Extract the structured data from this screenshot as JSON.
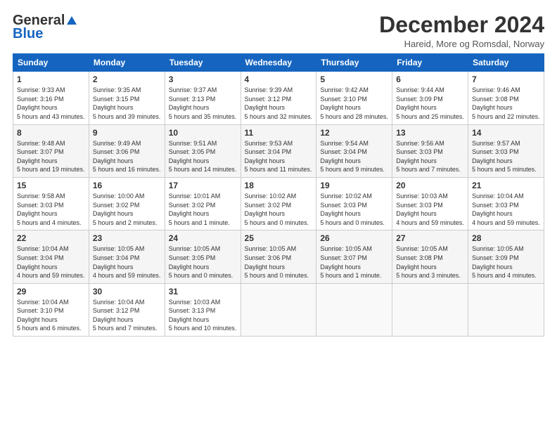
{
  "header": {
    "logo_general": "General",
    "logo_blue": "Blue",
    "title": "December 2024",
    "location": "Hareid, More og Romsdal, Norway"
  },
  "weekdays": [
    "Sunday",
    "Monday",
    "Tuesday",
    "Wednesday",
    "Thursday",
    "Friday",
    "Saturday"
  ],
  "weeks": [
    [
      {
        "day": "1",
        "sunrise": "9:33 AM",
        "sunset": "3:16 PM",
        "daylight": "5 hours and 43 minutes."
      },
      {
        "day": "2",
        "sunrise": "9:35 AM",
        "sunset": "3:15 PM",
        "daylight": "5 hours and 39 minutes."
      },
      {
        "day": "3",
        "sunrise": "9:37 AM",
        "sunset": "3:13 PM",
        "daylight": "5 hours and 35 minutes."
      },
      {
        "day": "4",
        "sunrise": "9:39 AM",
        "sunset": "3:12 PM",
        "daylight": "5 hours and 32 minutes."
      },
      {
        "day": "5",
        "sunrise": "9:42 AM",
        "sunset": "3:10 PM",
        "daylight": "5 hours and 28 minutes."
      },
      {
        "day": "6",
        "sunrise": "9:44 AM",
        "sunset": "3:09 PM",
        "daylight": "5 hours and 25 minutes."
      },
      {
        "day": "7",
        "sunrise": "9:46 AM",
        "sunset": "3:08 PM",
        "daylight": "5 hours and 22 minutes."
      }
    ],
    [
      {
        "day": "8",
        "sunrise": "9:48 AM",
        "sunset": "3:07 PM",
        "daylight": "5 hours and 19 minutes."
      },
      {
        "day": "9",
        "sunrise": "9:49 AM",
        "sunset": "3:06 PM",
        "daylight": "5 hours and 16 minutes."
      },
      {
        "day": "10",
        "sunrise": "9:51 AM",
        "sunset": "3:05 PM",
        "daylight": "5 hours and 14 minutes."
      },
      {
        "day": "11",
        "sunrise": "9:53 AM",
        "sunset": "3:04 PM",
        "daylight": "5 hours and 11 minutes."
      },
      {
        "day": "12",
        "sunrise": "9:54 AM",
        "sunset": "3:04 PM",
        "daylight": "5 hours and 9 minutes."
      },
      {
        "day": "13",
        "sunrise": "9:56 AM",
        "sunset": "3:03 PM",
        "daylight": "5 hours and 7 minutes."
      },
      {
        "day": "14",
        "sunrise": "9:57 AM",
        "sunset": "3:03 PM",
        "daylight": "5 hours and 5 minutes."
      }
    ],
    [
      {
        "day": "15",
        "sunrise": "9:58 AM",
        "sunset": "3:03 PM",
        "daylight": "5 hours and 4 minutes."
      },
      {
        "day": "16",
        "sunrise": "10:00 AM",
        "sunset": "3:02 PM",
        "daylight": "5 hours and 2 minutes."
      },
      {
        "day": "17",
        "sunrise": "10:01 AM",
        "sunset": "3:02 PM",
        "daylight": "5 hours and 1 minute."
      },
      {
        "day": "18",
        "sunrise": "10:02 AM",
        "sunset": "3:02 PM",
        "daylight": "5 hours and 0 minutes."
      },
      {
        "day": "19",
        "sunrise": "10:02 AM",
        "sunset": "3:03 PM",
        "daylight": "5 hours and 0 minutes."
      },
      {
        "day": "20",
        "sunrise": "10:03 AM",
        "sunset": "3:03 PM",
        "daylight": "4 hours and 59 minutes."
      },
      {
        "day": "21",
        "sunrise": "10:04 AM",
        "sunset": "3:03 PM",
        "daylight": "4 hours and 59 minutes."
      }
    ],
    [
      {
        "day": "22",
        "sunrise": "10:04 AM",
        "sunset": "3:04 PM",
        "daylight": "4 hours and 59 minutes."
      },
      {
        "day": "23",
        "sunrise": "10:05 AM",
        "sunset": "3:04 PM",
        "daylight": "4 hours and 59 minutes."
      },
      {
        "day": "24",
        "sunrise": "10:05 AM",
        "sunset": "3:05 PM",
        "daylight": "5 hours and 0 minutes."
      },
      {
        "day": "25",
        "sunrise": "10:05 AM",
        "sunset": "3:06 PM",
        "daylight": "5 hours and 0 minutes."
      },
      {
        "day": "26",
        "sunrise": "10:05 AM",
        "sunset": "3:07 PM",
        "daylight": "5 hours and 1 minute."
      },
      {
        "day": "27",
        "sunrise": "10:05 AM",
        "sunset": "3:08 PM",
        "daylight": "5 hours and 3 minutes."
      },
      {
        "day": "28",
        "sunrise": "10:05 AM",
        "sunset": "3:09 PM",
        "daylight": "5 hours and 4 minutes."
      }
    ],
    [
      {
        "day": "29",
        "sunrise": "10:04 AM",
        "sunset": "3:10 PM",
        "daylight": "5 hours and 6 minutes."
      },
      {
        "day": "30",
        "sunrise": "10:04 AM",
        "sunset": "3:12 PM",
        "daylight": "5 hours and 7 minutes."
      },
      {
        "day": "31",
        "sunrise": "10:03 AM",
        "sunset": "3:13 PM",
        "daylight": "5 hours and 10 minutes."
      },
      null,
      null,
      null,
      null
    ]
  ]
}
